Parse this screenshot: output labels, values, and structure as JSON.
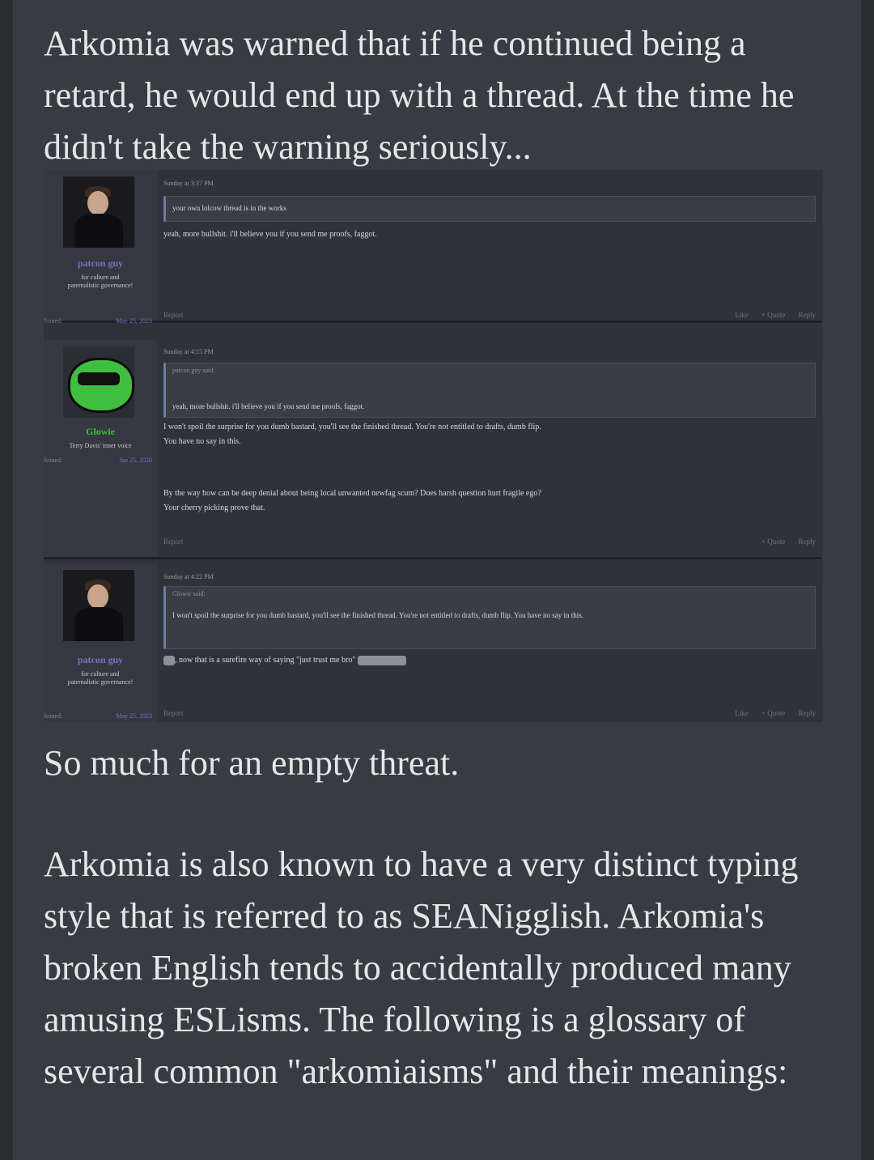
{
  "intro_paragraph": "Arkomia was warned that if he continued being a retard, he would end up with a thread. At the time he didn't take the warning seriously...",
  "forum_screenshot": {
    "posts": [
      {
        "username": "patcon guy",
        "user_title": "for culture and paternalistic governance!",
        "joined_label": "Joined:",
        "joined_date": "May 25, 2023",
        "timestamp": "Sunday at 3:37 PM",
        "quote_text": "your own lolcow thread is in the works",
        "message": "yeah, more bullshit. i'll believe you if you send me proofs, faggot.",
        "report": "Report",
        "actions": [
          "Like",
          "+ Quote",
          "Reply"
        ]
      },
      {
        "username": "Glowie",
        "user_title": "Terry Davis' inner voice",
        "joined_label": "Joined:",
        "joined_date": "Jan 25, 2020",
        "timestamp": "Sunday at 4:15 PM",
        "quote_by": "patcon guy said:",
        "quote_text": "yeah, more bullshit. i'll believe you if you send me proofs, faggot.",
        "message_lines": [
          "I won't spoil the surprise for you dumb bastard, you'll see the finished thread. You're not entitled to drafts, dumb flip.",
          "You have no say in this.",
          "",
          "By the way how can be deep denial about being local unwanted newfag scum? Does harsh question hurt fragile ego?",
          "Your cherry picking prove that."
        ],
        "report": "Report",
        "actions": [
          "+ Quote",
          "Reply"
        ]
      },
      {
        "username": "patcon guy",
        "user_title": "for culture and paternalistic governance!",
        "joined_label": "Joined:",
        "joined_date": "May 25, 2023",
        "timestamp": "Sunday at 4:22 PM",
        "quote_by": "Glowie said:",
        "quote_text": "I won't spoil the surprise for you dumb bastard, you'll see the finished thread. You're not entitled to drafts, dumb flip. You have no say in this.",
        "message": ", now that is a surefire way of saying \"just trust me bro\"",
        "report": "Report",
        "actions": [
          "Like",
          "+ Quote",
          "Reply"
        ]
      }
    ]
  },
  "after_paragraph": "So much for an empty threat.",
  "glossary_paragraph": "Arkomia is also known to have a very distinct typing style that is referred to as SEANigglish. Arkomia's broken English tends to accidentally produced many amusing ESLisms. The following is a glossary of several common \"arkomiaisms\" and their meanings:",
  "colors": {
    "page_bg": "#383b42",
    "text": "#e6e6e6",
    "patcon_name": "#7b6fc4",
    "glowie_name": "#3fbf3f"
  }
}
